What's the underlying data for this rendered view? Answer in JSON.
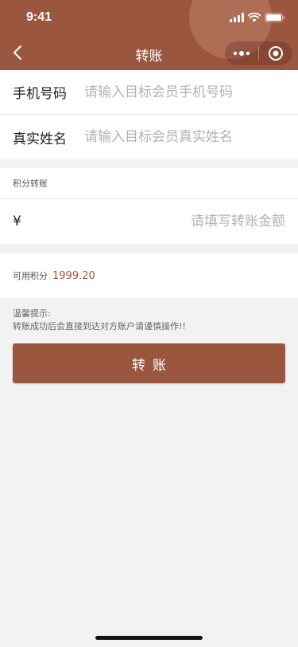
{
  "status_bar": {
    "time": "9:41"
  },
  "nav": {
    "title": "转账"
  },
  "form": {
    "phone": {
      "label": "手机号码",
      "placeholder": "请输入目标会员手机号码"
    },
    "name": {
      "label": "真实姓名",
      "placeholder": "请输入目标会员真实姓名"
    }
  },
  "points": {
    "section_title": "积分转账",
    "currency_symbol": "¥",
    "amount_placeholder": "请填写转账金额"
  },
  "available": {
    "label": "可用积分",
    "value": "1999.20"
  },
  "tips": {
    "title": "温馨提示:",
    "text": "转账成功后会直接到达对方账户请谨慎操作!!"
  },
  "submit": {
    "label": "转账"
  },
  "colors": {
    "accent": "#9b5640",
    "background": "#f2f2f2"
  }
}
